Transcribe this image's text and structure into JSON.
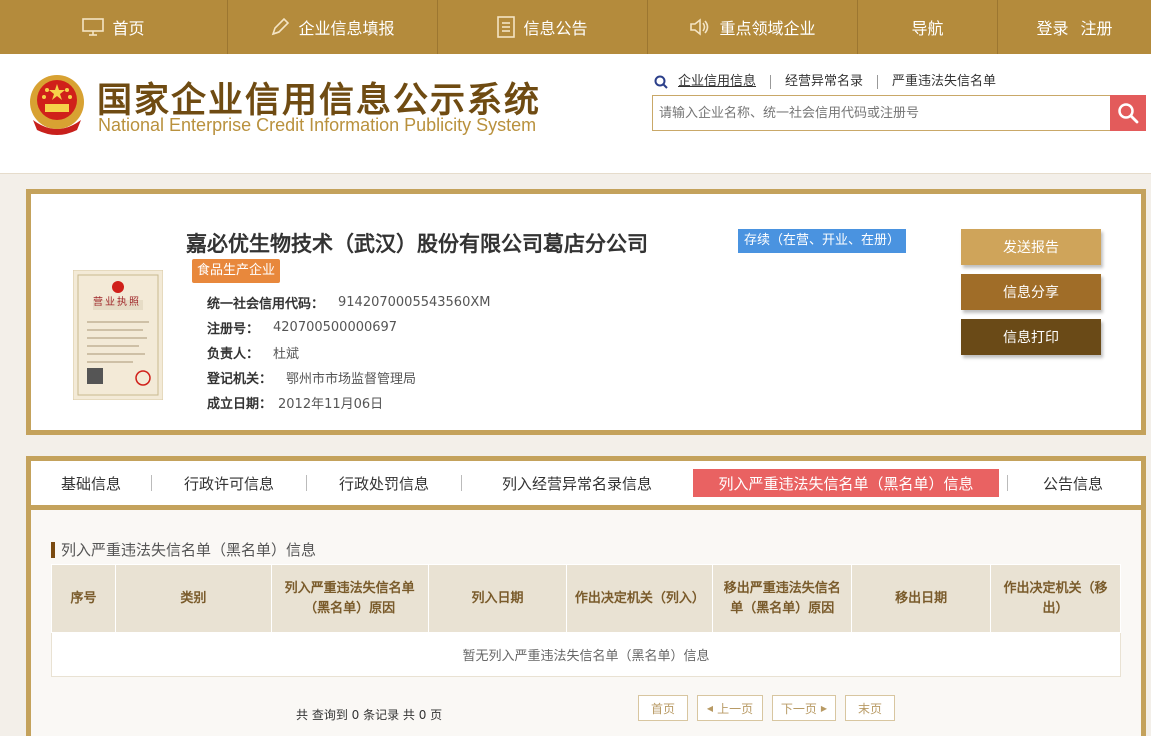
{
  "nav": {
    "home": "首页",
    "report": "企业信息填报",
    "notice": "信息公告",
    "key": "重点领域企业",
    "guide": "导航",
    "login": "登录",
    "register": "注册"
  },
  "header": {
    "title": "国家企业信用信息公示系统",
    "subtitle": "National Enterprise Credit Information Publicity System",
    "search_tabs": [
      "企业信用信息",
      "经营异常名录",
      "严重违法失信名单"
    ],
    "search_placeholder": "请输入企业名称、统一社会信用代码或注册号"
  },
  "company": {
    "name": "嘉必优生物技术（武汉）股份有限公司葛店分公司",
    "status": "存续（在营、开业、在册）",
    "tag": "食品生产企业",
    "fields": [
      {
        "label": "统一社会信用代码：",
        "value": "9142070005543560XM"
      },
      {
        "label": "注册号：",
        "value": "420700500000697"
      },
      {
        "label": "负责人：",
        "value": "杜斌"
      },
      {
        "label": "登记机关：",
        "value": "鄂州市市场监督管理局"
      },
      {
        "label": "成立日期：",
        "value": "2012年11月06日"
      }
    ],
    "license_label": "营业执照",
    "actions": {
      "send": "发送报告",
      "share": "信息分享",
      "print": "信息打印"
    }
  },
  "tabs": [
    "基础信息",
    "行政许可信息",
    "行政处罚信息",
    "列入经营异常名录信息",
    "列入严重违法失信名单（黑名单）信息",
    "公告信息"
  ],
  "section": {
    "title": "列入严重违法失信名单（黑名单）信息",
    "columns": [
      "序号",
      "类别",
      "列入严重违法失信名单（黑名单）原因",
      "列入日期",
      "作出决定机关（列入）",
      "移出严重违法失信名单（黑名单）原因",
      "移出日期",
      "作出决定机关（移出）"
    ],
    "empty": "暂无列入严重违法失信名单（黑名单）信息"
  },
  "pager": {
    "summary": "共 查询到 0 条记录 共 0 页",
    "first": "首页",
    "prev": "上一页",
    "next": "下一页",
    "last": "末页"
  },
  "colors": {
    "gold": "#b48b3c",
    "border": "#c4a25c",
    "accent_red": "#e96262",
    "status_blue": "#4a93e0",
    "tag_orange": "#e8883c"
  }
}
